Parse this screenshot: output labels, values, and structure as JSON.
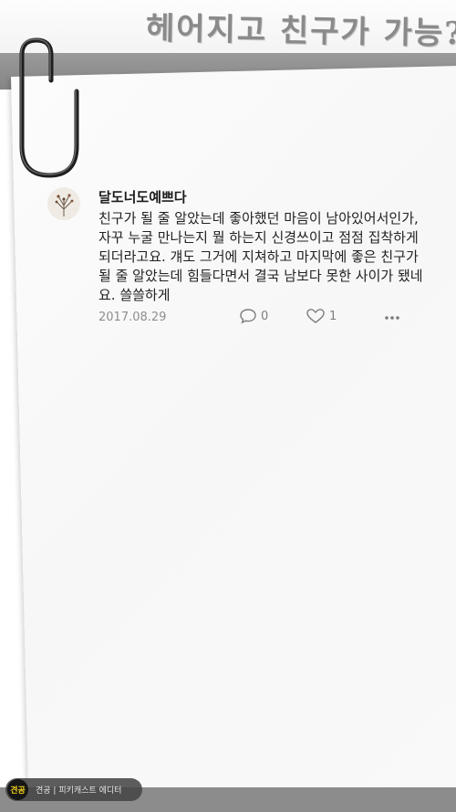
{
  "header": {
    "title": "헤어지고 친구가 가능?"
  },
  "post": {
    "username": "달도너도예쁘다",
    "body": "친구가 될 줄 알았는데 좋아했던 마음이 남아있어서인가, 자꾸 누굴 만나는지 뭘 하는지 신경쓰이고 점점 집착하게 되더라고요. 걔도 그거에 지쳐하고 마지막에 좋은 친구가 될 줄 알았는데 힘들다면서 결국 남보다 못한 사이가 됐네요. 쓸쓸하게",
    "date": "2017.08.29",
    "comment_count": "0",
    "like_count": "1",
    "icons": {
      "comment": "comment-bubble-icon",
      "like": "heart-icon",
      "more": "more-dots-icon"
    }
  },
  "footer": {
    "logo_text": "견공",
    "credit": "견공 | 피키캐스트 에디터"
  },
  "colors": {
    "band_gray": "#8c8c8c",
    "text_dark": "#222222",
    "meta_gray": "#8e8e8e",
    "logo_yellow": "#f4d21a"
  }
}
